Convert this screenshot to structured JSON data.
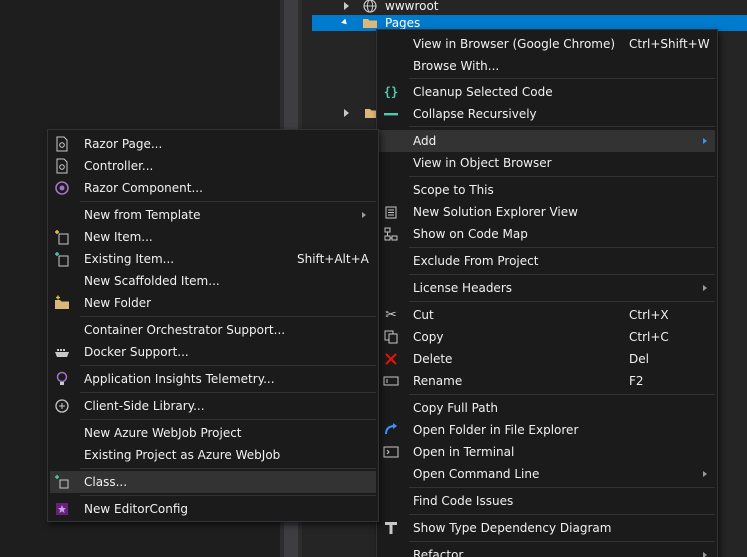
{
  "solution_explorer": {
    "items": [
      {
        "label": "wwwroot"
      },
      {
        "label": "Pages"
      }
    ]
  },
  "context_menu": {
    "items": [
      {
        "label": "View in Browser (Google Chrome)",
        "shortcut": "Ctrl+Shift+W",
        "icon": "none"
      },
      {
        "label": "Browse With...",
        "shortcut": "",
        "icon": "none"
      },
      {
        "label": "Cleanup Selected Code",
        "shortcut": "",
        "icon": "braces-icon"
      },
      {
        "label": "Collapse Recursively",
        "shortcut": "",
        "icon": "collapse-icon"
      },
      {
        "label": "Add",
        "shortcut": "",
        "icon": "none",
        "submenu": true
      },
      {
        "label": "View in Object Browser",
        "shortcut": "",
        "icon": "none"
      },
      {
        "label": "Scope to This",
        "shortcut": "",
        "icon": "none"
      },
      {
        "label": "New Solution Explorer View",
        "shortcut": "",
        "icon": "new-view-icon"
      },
      {
        "label": "Show on Code Map",
        "shortcut": "",
        "icon": "code-map-icon"
      },
      {
        "label": "Exclude From Project",
        "shortcut": "",
        "icon": "none"
      },
      {
        "label": "License Headers",
        "shortcut": "",
        "icon": "none",
        "submenu": true
      },
      {
        "label": "Cut",
        "shortcut": "Ctrl+X",
        "icon": "scissors-icon"
      },
      {
        "label": "Copy",
        "shortcut": "Ctrl+C",
        "icon": "copy-icon"
      },
      {
        "label": "Delete",
        "shortcut": "Del",
        "icon": "delete-x-icon"
      },
      {
        "label": "Rename",
        "shortcut": "F2",
        "icon": "rename-icon"
      },
      {
        "label": "Copy Full Path",
        "shortcut": "",
        "icon": "none"
      },
      {
        "label": "Open Folder in File Explorer",
        "shortcut": "",
        "icon": "open-folder-arrow-icon"
      },
      {
        "label": "Open in Terminal",
        "shortcut": "",
        "icon": "terminal-icon"
      },
      {
        "label": "Open Command Line",
        "shortcut": "",
        "icon": "none",
        "submenu": true
      },
      {
        "label": "Find Code Issues",
        "shortcut": "",
        "icon": "none"
      },
      {
        "label": "Show Type Dependency Diagram",
        "shortcut": "",
        "icon": "type-diagram-icon"
      },
      {
        "label": "Refactor",
        "shortcut": "",
        "icon": "none",
        "submenu": true
      }
    ]
  },
  "add_submenu": {
    "items": [
      {
        "label": "Razor Page...",
        "shortcut": "",
        "icon": "razor-page-icon"
      },
      {
        "label": "Controller...",
        "shortcut": "",
        "icon": "controller-icon"
      },
      {
        "label": "Razor Component...",
        "shortcut": "",
        "icon": "razor-component-icon"
      },
      {
        "label": "New from Template",
        "shortcut": "",
        "icon": "none",
        "submenu": true
      },
      {
        "label": "New Item...",
        "shortcut": "",
        "icon": "new-item-icon"
      },
      {
        "label": "Existing Item...",
        "shortcut": "Shift+Alt+A",
        "icon": "existing-item-icon"
      },
      {
        "label": "New Scaffolded Item...",
        "shortcut": "",
        "icon": "none"
      },
      {
        "label": "New Folder",
        "shortcut": "",
        "icon": "new-folder-icon"
      },
      {
        "label": "Container Orchestrator Support...",
        "shortcut": "",
        "icon": "none"
      },
      {
        "label": "Docker Support...",
        "shortcut": "",
        "icon": "docker-icon"
      },
      {
        "label": "Application Insights Telemetry...",
        "shortcut": "",
        "icon": "app-insights-icon"
      },
      {
        "label": "Client-Side Library...",
        "shortcut": "",
        "icon": "client-library-icon"
      },
      {
        "label": "New Azure WebJob Project",
        "shortcut": "",
        "icon": "none"
      },
      {
        "label": "Existing Project as Azure WebJob",
        "shortcut": "",
        "icon": "none"
      },
      {
        "label": "Class...",
        "shortcut": "",
        "icon": "class-icon"
      },
      {
        "label": "New EditorConfig",
        "shortcut": "",
        "icon": "editorconfig-icon"
      }
    ]
  },
  "colors": {
    "selection": "#007acc",
    "menu_bg": "#1b1b1c",
    "menu_highlight": "#333334",
    "accent_blue": "#3794ff",
    "delete_red": "#e51400"
  }
}
